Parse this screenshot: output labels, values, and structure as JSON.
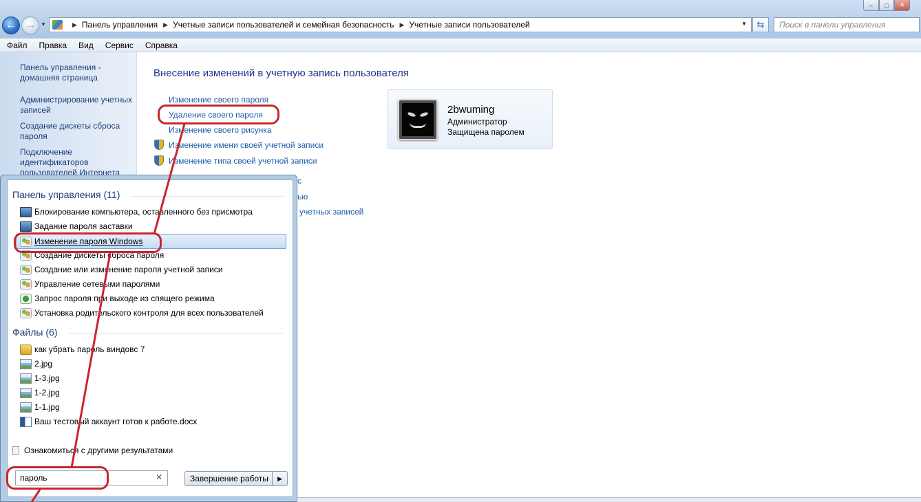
{
  "window": {
    "breadcrumbs": [
      "Панель управления",
      "Учетные записи пользователей и семейная безопасность",
      "Учетные записи пользователей"
    ],
    "search_placeholder": "Поиск в панели управления"
  },
  "menubar": [
    "Файл",
    "Правка",
    "Вид",
    "Сервис",
    "Справка"
  ],
  "sidebar": {
    "links": [
      "Панель управления - домашняя страница",
      "Администрирование учетных записей",
      "Создание дискеты сброса пароля",
      "Подключение идентификаторов пользователей Интернета"
    ]
  },
  "main": {
    "title": "Внесение изменений в учетную запись пользователя",
    "tasks": [
      "Изменение своего пароля",
      "Удаление своего пароля",
      "Изменение своего рисунка",
      "Изменение имени своей учетной записи",
      "Изменение типа своей учетной записи"
    ],
    "hidden_tasks_visible_parts": [
      "с",
      "ью",
      "учетных записей"
    ]
  },
  "user": {
    "name": "2bwuming",
    "role": "Администратор",
    "status": "Защищена паролем"
  },
  "start_menu": {
    "control_panel_header": "Панель управления (11)",
    "control_panel_items": [
      {
        "label": "Блокирование компьютера, оставленного без присмотра",
        "icon": "monitor-icon"
      },
      {
        "label": "Задание пароля заставки",
        "icon": "monitor-icon"
      },
      {
        "label": "Изменение пароля Windows",
        "icon": "users-icon"
      },
      {
        "label": "Создание дискеты сброса пароля",
        "icon": "users-icon"
      },
      {
        "label": "Создание или изменение пароля учетной записи",
        "icon": "users-icon"
      },
      {
        "label": "Управление сетевыми паролями",
        "icon": "users-icon"
      },
      {
        "label": "Запрос пароля при выходе из спящего режима",
        "icon": "power-options-icon"
      },
      {
        "label": "Установка родительского контроля для всех пользователей",
        "icon": "parental-control-icon"
      }
    ],
    "files_header": "Файлы (6)",
    "file_items": [
      {
        "label": "как убрать пароль виндовс 7",
        "icon": "folder-icon"
      },
      {
        "label": "2.jpg",
        "icon": "image-icon"
      },
      {
        "label": "1-3.jpg",
        "icon": "image-icon"
      },
      {
        "label": "1-2.jpg",
        "icon": "image-icon"
      },
      {
        "label": "1-1.jpg",
        "icon": "image-icon"
      },
      {
        "label": "Ваш тестовый аккаунт готов к работе.docx",
        "icon": "word-doc-icon"
      }
    ],
    "more_results": "Ознакомиться с другими результатами",
    "search_value": "пароль",
    "shutdown_label": "Завершение работы"
  },
  "colors": {
    "annotation": "#c8262b",
    "link": "#1c5fa8",
    "title": "#1e3287"
  }
}
